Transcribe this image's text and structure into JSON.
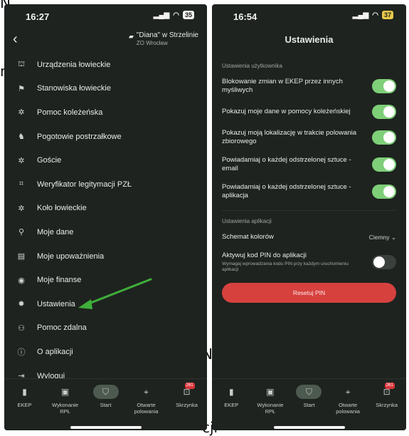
{
  "background": {
    "fragment_top": "N.",
    "fragment_m": "m",
    "fragment_n": "N.",
    "fragment_bottom": "cji"
  },
  "left_phone": {
    "status": {
      "time": "16:27",
      "battery": "35"
    },
    "header": {
      "hunt_name": "\"Diana\" w Strzelinie",
      "hunt_sub": "ZO Wrocław"
    },
    "menu": [
      {
        "label": "Urządzenia łowieckie",
        "icon": "tower-icon"
      },
      {
        "label": "Stanowiska łowieckie",
        "icon": "flag-icon"
      },
      {
        "label": "Pomoc koleżeńska",
        "icon": "people-icon"
      },
      {
        "label": "Pogotowie postrzałkowe",
        "icon": "dog-icon"
      },
      {
        "label": "Goście",
        "icon": "guests-icon"
      },
      {
        "label": "Weryfikator legitymacji PZŁ",
        "icon": "scan-icon"
      },
      {
        "label": "Koło łowieckie",
        "icon": "club-icon"
      },
      {
        "label": "Moje dane",
        "icon": "person-icon"
      },
      {
        "label": "Moje upoważnienia",
        "icon": "document-icon"
      },
      {
        "label": "Moje finanse",
        "icon": "piggy-bank-icon"
      },
      {
        "label": "Ustawienia",
        "icon": "gear-icon"
      },
      {
        "label": "Pomoc zdalna",
        "icon": "remote-help-icon"
      },
      {
        "label": "O aplikacji",
        "icon": "info-icon"
      },
      {
        "label": "Wyloguj",
        "icon": "logout-icon"
      }
    ],
    "nav": [
      {
        "label": "EKEP",
        "icon": "ekep-icon"
      },
      {
        "label": "Wykonanie RPŁ",
        "icon": "calendar-icon"
      },
      {
        "label": "Start",
        "icon": "shield-icon",
        "active": true
      },
      {
        "label": "Otwarte polowania",
        "icon": "target-icon"
      },
      {
        "label": "Skrzynka",
        "icon": "inbox-icon",
        "badge": "261"
      }
    ],
    "arrow_color": "#3fae3a"
  },
  "right_phone": {
    "status": {
      "time": "16:54",
      "battery": "37"
    },
    "title": "Ustawienia",
    "user_section_title": "Ustawienia użytkownika",
    "user_settings": [
      {
        "label": "Blokowanie zmian w EKEP przez innych myśliwych",
        "on": true
      },
      {
        "label": "Pokazuj moje dane w pomocy koleżeńskiej",
        "on": true
      },
      {
        "label": "Pokazuj moją lokalizację w trakcie polowania zbiorowego",
        "on": true
      },
      {
        "label": "Powiadamiaj o każdej odstrzelonej sztuce - email",
        "on": true
      },
      {
        "label": "Powiadamiaj o każdej odstrzelonej sztuce - aplikacja",
        "on": true
      }
    ],
    "app_section_title": "Ustawienia aplikacji",
    "color_scheme": {
      "label": "Schemat kolorów",
      "value": "Ciemny"
    },
    "pin": {
      "label": "Aktywuj kod PIN do aplikacji",
      "description": "Wymagaj wprowadzania kodu PIN przy każdym uruchomieniu aplikacji",
      "on": false
    },
    "reset_button": "Resetuj PIN",
    "nav": [
      {
        "label": "EKEP",
        "icon": "ekep-icon"
      },
      {
        "label": "Wykonanie RPŁ",
        "icon": "calendar-icon"
      },
      {
        "label": "Start",
        "icon": "shield-icon",
        "active": true
      },
      {
        "label": "Otwarte polowania",
        "icon": "target-icon"
      },
      {
        "label": "Skrzynka",
        "icon": "inbox-icon",
        "badge": "261"
      }
    ]
  },
  "colors": {
    "background": "#1e231f",
    "toggle_on": "#7ecf78",
    "reset_button": "#d6413e",
    "accent_green": "#3fae3a"
  }
}
